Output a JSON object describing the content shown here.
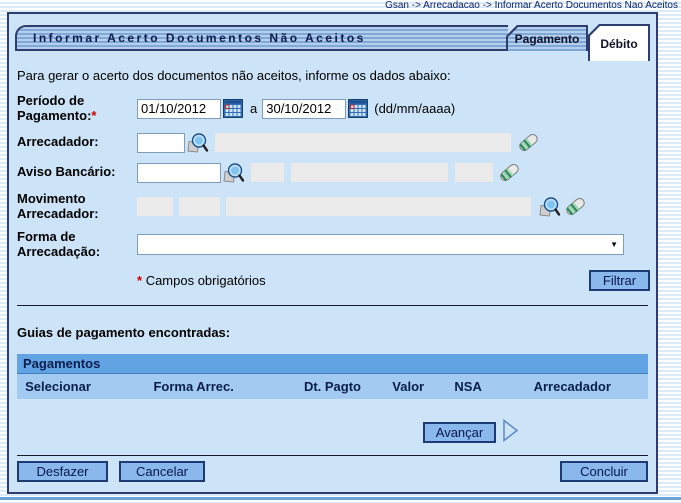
{
  "colors": {
    "content_bg": "#cde4f8",
    "border_navy": "#2e3d6e",
    "table_title_bg": "#61a3e3",
    "table_header_bg": "#a3caf0",
    "button_bg": "#8ab7ec",
    "required_red": "#cc0000"
  },
  "breadcrumb": "Gsan -> Arrecadacao -> Informar Acerto Documentos Nao Aceitos",
  "header": {
    "title": "Informar Acerto Documentos Não Aceitos",
    "tabs": [
      {
        "label": "Pagamento",
        "active": true
      },
      {
        "label": "Débito",
        "active": false
      }
    ]
  },
  "intro": "Para gerar o acerto dos documentos não aceitos, informe os dados abaixo:",
  "form": {
    "required_mark": "*",
    "periodo": {
      "label": "Período de Pagamento:",
      "date_from": "01/10/2012",
      "date_to": "30/10/2012",
      "between": "a",
      "format_hint": "(dd/mm/aaaa)"
    },
    "arrecadador": {
      "label": "Arrecadador:",
      "code": "",
      "description": ""
    },
    "aviso_bancario": {
      "label": "Aviso Bancário:",
      "code": "",
      "field1": "",
      "field2": "",
      "field3": ""
    },
    "movimento": {
      "label": "Movimento Arrecadador:",
      "field1": "",
      "field2": "",
      "field3": ""
    },
    "forma": {
      "label": "Forma de Arrecadação:",
      "value": ""
    },
    "required_note": "Campos obrigatórios",
    "filtrar_button": "Filtrar"
  },
  "results": {
    "heading": "Guias de pagamento encontradas:",
    "table": {
      "title": "Pagamentos",
      "columns": [
        "Selecionar",
        "Forma Arrec.",
        "Dt. Pagto",
        "Valor",
        "NSA",
        "Arrecadador"
      ],
      "rows": []
    },
    "avancar_button": "Avançar"
  },
  "footer": {
    "desfazer_button": "Desfazer",
    "cancelar_button": "Cancelar",
    "concluir_button": "Concluir"
  }
}
